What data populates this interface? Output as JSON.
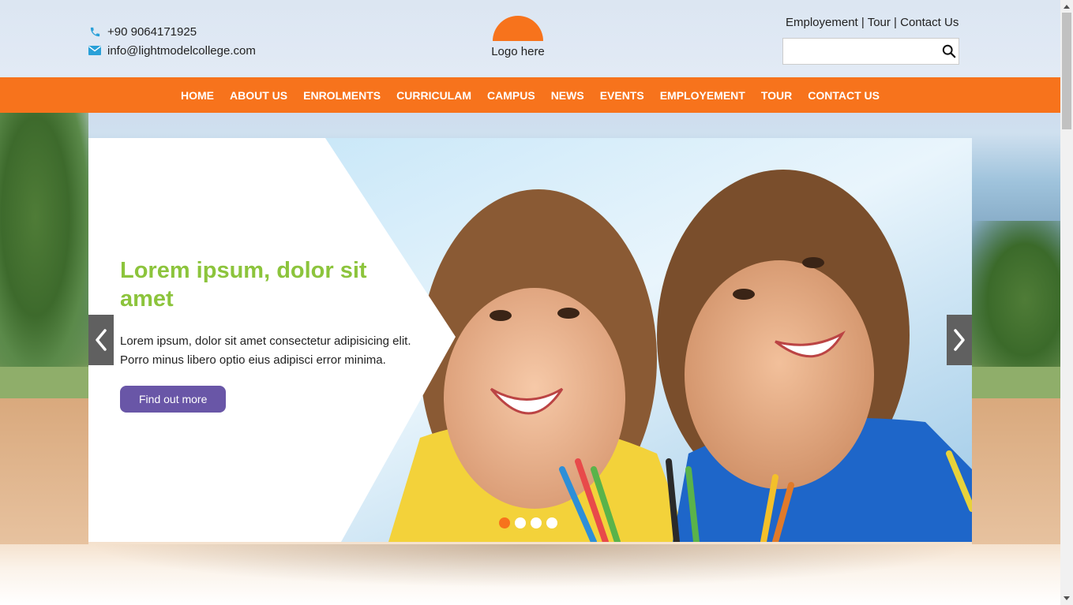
{
  "header": {
    "phone": "+90 9064171925",
    "email": "info@lightmodelcollege.com",
    "logo_text": "Logo here",
    "top_links": [
      "Employement",
      "Tour",
      "Contact Us"
    ],
    "search": {
      "value": "",
      "placeholder": ""
    }
  },
  "nav": {
    "items": [
      "HOME",
      "ABOUT US",
      "ENROLMENTS",
      "CURRICULAM",
      "CAMPUS",
      "NEWS",
      "EVENTS",
      "EMPLOYEMENT",
      "TOUR",
      "CONTACT US"
    ]
  },
  "slider": {
    "title": "Lorem ipsum, dolor sit amet",
    "text": "Lorem ipsum, dolor sit amet consectetur adipisicing elit. Porro minus libero optio eius adipisci error minima.",
    "button_label": "Find out more",
    "dots_count": 4,
    "active_dot": 1
  },
  "colors": {
    "accent": "#f7731c",
    "title_green": "#8cc43c",
    "button_purple": "#6956a7",
    "icon_blue": "#2aa0d8"
  },
  "icons": {
    "phone": "phone-icon",
    "email": "envelope-icon",
    "search": "search-icon",
    "prev": "chevron-left-icon",
    "next": "chevron-right-icon"
  }
}
